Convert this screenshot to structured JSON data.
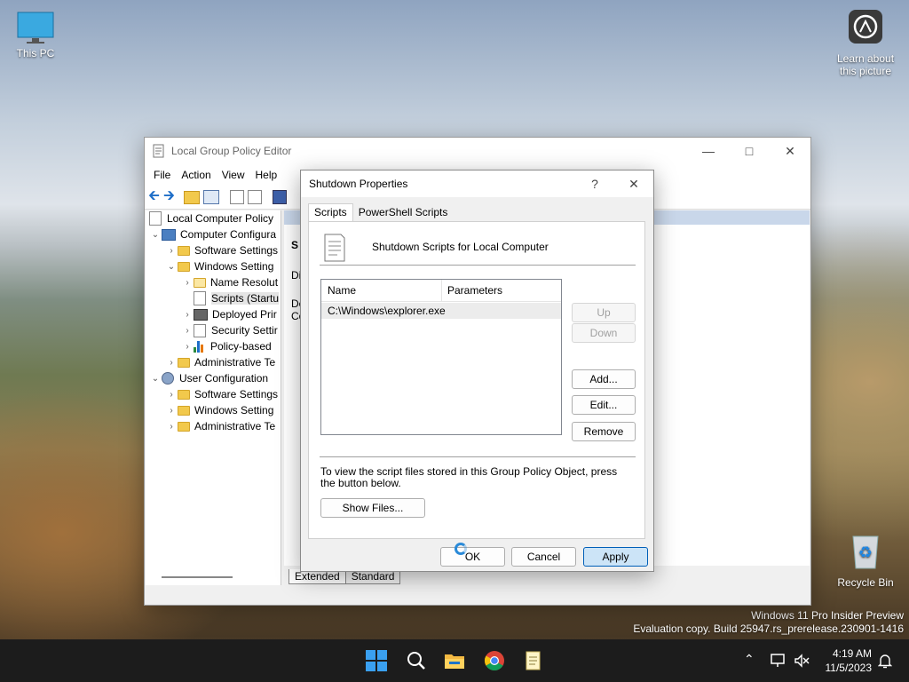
{
  "desktop": {
    "this_pc_label": "This PC",
    "learn_label_1": "Learn about",
    "learn_label_2": "this picture",
    "recycle_label": "Recycle Bin",
    "watermark_1": "Windows 11 Pro Insider Preview",
    "watermark_2": "Evaluation copy. Build 25947.rs_prerelease.230901-1416"
  },
  "gpedit": {
    "title": "Local Group Policy Editor",
    "menu": [
      "File",
      "Action",
      "View",
      "Help"
    ],
    "tree": {
      "root": "Local Computer Policy",
      "computer_config": "Computer Configura",
      "software_settings": "Software Settings",
      "windows_settings": "Windows Setting",
      "name_resolution": "Name Resolut",
      "scripts": "Scripts (Startu",
      "deployed_printers": "Deployed Prir",
      "security_settings": "Security Settir",
      "policy_based": "Policy-based",
      "admin_templates": "Administrative Te",
      "user_config": "User Configuration",
      "user_software": "Software Settings",
      "user_windows": "Windows Setting",
      "user_admin": "Administrative Te"
    },
    "right_fragments": {
      "s": "S",
      "di": "Di",
      "de": "De",
      "co": "Co"
    },
    "tabs": [
      "Extended",
      "Standard"
    ]
  },
  "dialog": {
    "title": "Shutdown Properties",
    "help_glyph": "?",
    "tabs": [
      "Scripts",
      "PowerShell Scripts"
    ],
    "heading": "Shutdown Scripts for Local Computer",
    "columns": [
      "Name",
      "Parameters"
    ],
    "rows": [
      {
        "name": "C:\\Windows\\explorer.exe",
        "params": ""
      }
    ],
    "buttons": {
      "up": "Up",
      "down": "Down",
      "add": "Add...",
      "edit": "Edit...",
      "remove": "Remove"
    },
    "info_1": "To view the script files stored in this Group Policy Object, press",
    "info_2": "the button below.",
    "show_files": "Show Files...",
    "ok": "OK",
    "cancel": "Cancel",
    "apply": "Apply"
  },
  "taskbar": {
    "time": "4:19 AM",
    "date": "11/5/2023"
  },
  "colors": {
    "accent": "#005fb8",
    "taskbar": "#1c1c1c",
    "chrome_panel": "#f0f0f0"
  }
}
